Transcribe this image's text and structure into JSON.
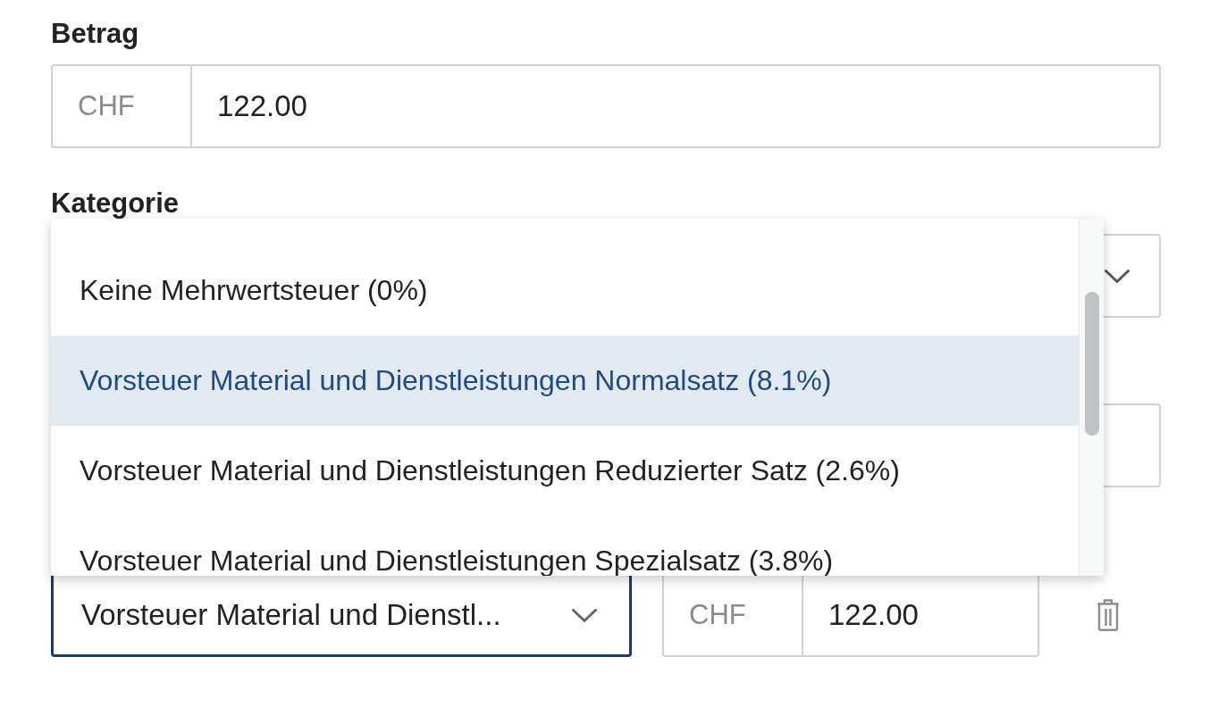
{
  "amount_field": {
    "label": "Betrag",
    "currency": "CHF",
    "value": "122.00"
  },
  "category_field": {
    "label": "Kategorie",
    "dropdown": {
      "open": true,
      "options": [
        {
          "label": "Keine Mehrwertsteuer (0%)",
          "selected": false
        },
        {
          "label": "Vorsteuer Material und Dienstleistungen Normalsatz (8.1%)",
          "selected": true
        },
        {
          "label": "Vorsteuer Material und Dienstleistungen Reduzierter Satz (2.6%)",
          "selected": false
        },
        {
          "label": "Vorsteuer Material und Dienstleistungen Spezialsatz (3.8%)",
          "selected": false
        }
      ]
    }
  },
  "split_row": {
    "tax_select": {
      "value": "Vorsteuer Material und Dienstl...",
      "focused": true
    },
    "currency": "CHF",
    "amount": "122.00"
  }
}
